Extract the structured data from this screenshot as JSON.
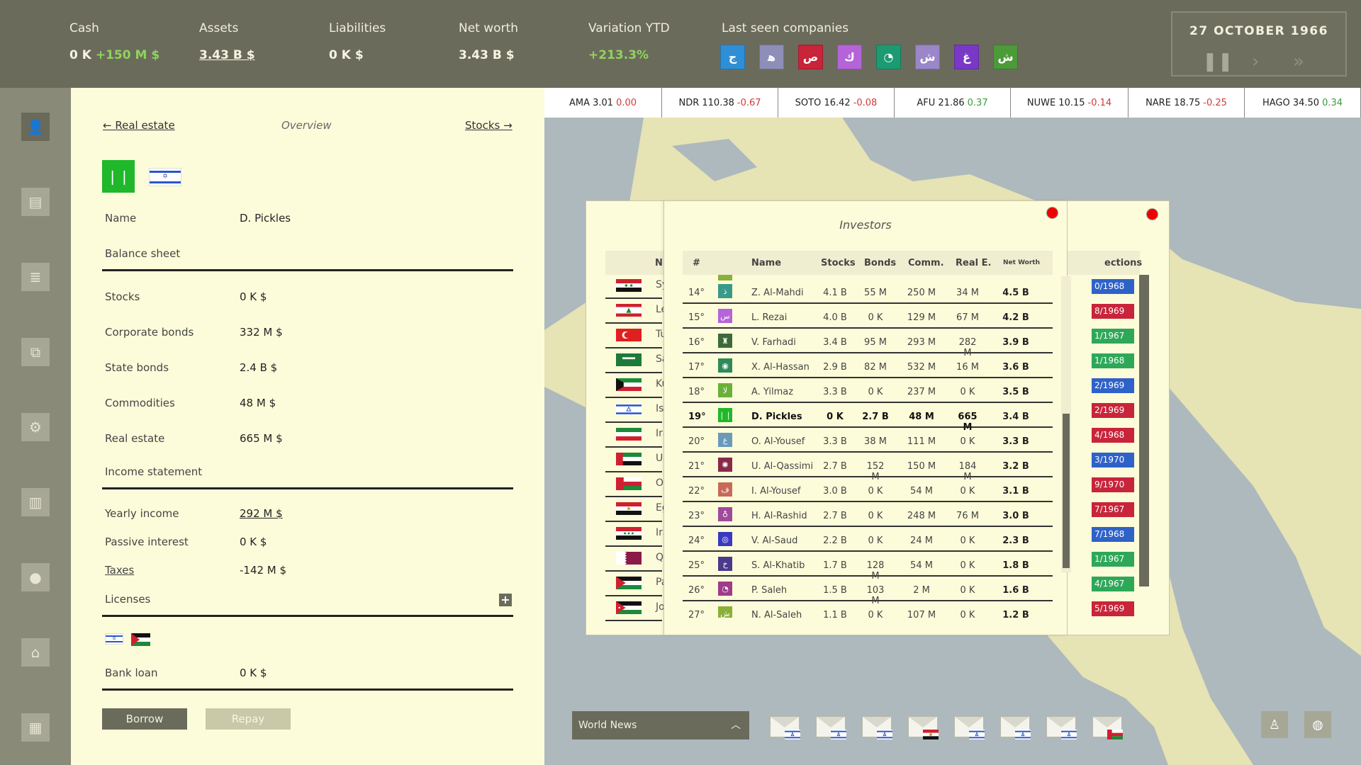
{
  "top": {
    "cash_label": "Cash",
    "cash_value": "0 K",
    "cash_delta": "+150 M $",
    "assets_label": "Assets",
    "assets_value": "3.43 B $",
    "liabilities_label": "Liabilities",
    "liabilities_value": "0 K $",
    "networth_label": "Net worth",
    "networth_value": "3.43 B $",
    "variation_label": "Variation YTD",
    "variation_value": "+213.3%",
    "last_seen_label": "Last seen companies",
    "companies": [
      {
        "glyph": "ج",
        "color": "#2f8fd6"
      },
      {
        "glyph": "ﻫ",
        "color": "#8d8fb8"
      },
      {
        "glyph": "ص",
        "color": "#c8243a"
      },
      {
        "glyph": "ك",
        "color": "#b464d8"
      },
      {
        "glyph": "◔",
        "color": "#1c9a72"
      },
      {
        "glyph": "ش",
        "color": "#9a86c8"
      },
      {
        "glyph": "غ",
        "color": "#7a38c6"
      },
      {
        "glyph": "ش",
        "color": "#4c9a38"
      }
    ],
    "date": "27 OCTOBER 1966",
    "pause_icon": "pause-icon",
    "play_icon": "play-icon",
    "fast_icon": "fast-forward-icon"
  },
  "sidebar": [
    {
      "name": "sidebar-profile",
      "icon": "person-icon",
      "glyph": "👤",
      "active": true
    },
    {
      "name": "sidebar-documents",
      "icon": "document-icon",
      "glyph": "▤"
    },
    {
      "name": "sidebar-database",
      "icon": "database-icon",
      "glyph": "≣"
    },
    {
      "name": "sidebar-papers",
      "icon": "papers-icon",
      "glyph": "⧉"
    },
    {
      "name": "sidebar-settings",
      "icon": "gear-icon",
      "glyph": "⚙"
    },
    {
      "name": "sidebar-buildings",
      "icon": "building-icon",
      "glyph": "▥"
    },
    {
      "name": "sidebar-oil",
      "icon": "oil-drop-icon",
      "glyph": "●"
    },
    {
      "name": "sidebar-bank",
      "icon": "bank-icon",
      "glyph": "⌂"
    },
    {
      "name": "sidebar-factory",
      "icon": "factory-icon",
      "glyph": "▦"
    }
  ],
  "panel": {
    "nav_prev": "← Real estate",
    "nav_mid": "Overview",
    "nav_next": "Stocks →",
    "logo_glyph": "❘❘",
    "name_label": "Name",
    "name_value": "D. Pickles",
    "balance_title": "Balance sheet",
    "stocks_label": "Stocks",
    "stocks_value": "0 K $",
    "corp_label": "Corporate bonds",
    "corp_value": "332 M $",
    "state_label": "State bonds",
    "state_value": "2.4 B $",
    "comm_label": "Commodities",
    "comm_value": "48 M $",
    "re_label": "Real estate",
    "re_value": "665 M $",
    "income_title": "Income statement",
    "yearly_label": "Yearly income",
    "yearly_value": "292 M $",
    "passive_label": "Passive interest",
    "passive_value": "0 K $",
    "taxes_label": "Taxes",
    "taxes_value": "-142 M $",
    "licenses_title": "Licenses",
    "licenses_add": "+",
    "loan_label": "Bank loan",
    "loan_value": "0 K $",
    "borrow": "Borrow",
    "repay": "Repay"
  },
  "ticker": [
    {
      "sym": "AMA",
      "price": "3.01",
      "chg": "0.00",
      "dir": "neg"
    },
    {
      "sym": "NDR",
      "price": "110.38",
      "chg": "-0.67",
      "dir": "neg"
    },
    {
      "sym": "SOTO",
      "price": "16.42",
      "chg": "-0.08",
      "dir": "neg"
    },
    {
      "sym": "AFU",
      "price": "21.86",
      "chg": "0.37",
      "dir": "up"
    },
    {
      "sym": "NUWE",
      "price": "10.15",
      "chg": "-0.14",
      "dir": "neg"
    },
    {
      "sym": "NARE",
      "price": "18.75",
      "chg": "-0.25",
      "dir": "neg"
    },
    {
      "sym": "HAGO",
      "price": "34.50",
      "chg": "0.34",
      "dir": "up"
    }
  ],
  "elections": {
    "col_name": "N",
    "col_elections": "ections",
    "rows": [
      {
        "name": "Sy",
        "flag": "syria",
        "date": "0/1968",
        "color": "#2f62c8"
      },
      {
        "name": "Le",
        "flag": "lebanon",
        "date": "8/1969",
        "color": "#c8243a"
      },
      {
        "name": "Tu",
        "flag": "turkey",
        "date": "1/1967",
        "color": "#2ea858"
      },
      {
        "name": "Sa",
        "flag": "saudi",
        "date": "1/1968",
        "color": "#2ea858"
      },
      {
        "name": "Ku",
        "flag": "kuwait",
        "date": "2/1969",
        "color": "#2f62c8"
      },
      {
        "name": "Is",
        "flag": "israel",
        "date": "2/1969",
        "color": "#c8243a"
      },
      {
        "name": "Ira",
        "flag": "iran",
        "date": "4/1968",
        "color": "#c8243a"
      },
      {
        "name": "U.",
        "flag": "uae",
        "date": "3/1970",
        "color": "#2f62c8"
      },
      {
        "name": "O",
        "flag": "oman",
        "date": "9/1970",
        "color": "#c8243a"
      },
      {
        "name": "Eg",
        "flag": "egypt",
        "date": "7/1967",
        "color": "#c8243a"
      },
      {
        "name": "Ira",
        "flag": "iraq",
        "date": "7/1968",
        "color": "#2f62c8"
      },
      {
        "name": "Q",
        "flag": "qatar",
        "date": "1/1967",
        "color": "#2ea858"
      },
      {
        "name": "Pa",
        "flag": "palestine",
        "date": "4/1967",
        "color": "#2ea858"
      },
      {
        "name": "Jo",
        "flag": "jordan",
        "date": "5/1969",
        "color": "#c8243a"
      }
    ]
  },
  "investors": {
    "title": "Investors",
    "headers": {
      "rank": "#",
      "name": "Name",
      "stocks": "Stocks",
      "bonds": "Bonds",
      "comm": "Comm.",
      "re": "Real E.",
      "nw": "Net Worth"
    },
    "rows": [
      {
        "rank": "14°",
        "name": "Z. Al-Mahdi",
        "stocks": "4.1 B",
        "bonds": "55 M",
        "comm": "250 M",
        "re": "34 M",
        "nw": "4.5 B",
        "icon": "ذ",
        "color": "#3a9a8a"
      },
      {
        "rank": "15°",
        "name": "L. Rezai",
        "stocks": "4.0 B",
        "bonds": "0 K",
        "comm": "129 M",
        "re": "67 M",
        "nw": "4.2 B",
        "icon": "س",
        "color": "#b464d8"
      },
      {
        "rank": "16°",
        "name": "V. Farhadi",
        "stocks": "3.4 B",
        "bonds": "95 M",
        "comm": "293 M",
        "re": "282 M",
        "nw": "3.9 B",
        "icon": "♜",
        "color": "#3e6a3a"
      },
      {
        "rank": "17°",
        "name": "X. Al-Hassan",
        "stocks": "2.9 B",
        "bonds": "82 M",
        "comm": "532 M",
        "re": "16 M",
        "nw": "3.6 B",
        "icon": "◉",
        "color": "#2e8a58"
      },
      {
        "rank": "18°",
        "name": "A. Yilmaz",
        "stocks": "3.3 B",
        "bonds": "0 K",
        "comm": "237 M",
        "re": "0 K",
        "nw": "3.5 B",
        "icon": "ﻻ",
        "color": "#6ab03a"
      },
      {
        "rank": "19°",
        "name": "D. Pickles",
        "stocks": "0 K",
        "bonds": "2.7 B",
        "comm": "48 M",
        "re": "665 M",
        "nw": "3.4 B",
        "icon": "❘❘",
        "color": "#1fb82a",
        "hl": true
      },
      {
        "rank": "20°",
        "name": "O. Al-Yousef",
        "stocks": "3.3 B",
        "bonds": "38 M",
        "comm": "111 M",
        "re": "0 K",
        "nw": "3.3 B",
        "icon": "ع",
        "color": "#6a9ab8"
      },
      {
        "rank": "21°",
        "name": "U. Al-Qassimi",
        "stocks": "2.7 B",
        "bonds": "152 M",
        "comm": "150 M",
        "re": "184 M",
        "nw": "3.2 B",
        "icon": "✺",
        "color": "#8a2a4a"
      },
      {
        "rank": "22°",
        "name": "I. Al-Yousef",
        "stocks": "3.0 B",
        "bonds": "0 K",
        "comm": "54 M",
        "re": "0 K",
        "nw": "3.1 B",
        "icon": "ف",
        "color": "#c86a5a"
      },
      {
        "rank": "23°",
        "name": "H. Al-Rashid",
        "stocks": "2.7 B",
        "bonds": "0 K",
        "comm": "248 M",
        "re": "76 M",
        "nw": "3.0 B",
        "icon": "♁",
        "color": "#a04a9a"
      },
      {
        "rank": "24°",
        "name": "V. Al-Saud",
        "stocks": "2.2 B",
        "bonds": "0 K",
        "comm": "24 M",
        "re": "0 K",
        "nw": "2.3 B",
        "icon": "◎",
        "color": "#3a3ac0"
      },
      {
        "rank": "25°",
        "name": "S. Al-Khatib",
        "stocks": "1.7 B",
        "bonds": "128 M",
        "comm": "54 M",
        "re": "0 K",
        "nw": "1.8 B",
        "icon": "خ",
        "color": "#4a3a8a"
      },
      {
        "rank": "26°",
        "name": "P. Saleh",
        "stocks": "1.5 B",
        "bonds": "103 M",
        "comm": "2 M",
        "re": "0 K",
        "nw": "1.6 B",
        "icon": "◔",
        "color": "#a03a8a"
      },
      {
        "rank": "27°",
        "name": "N. Al-Saleh",
        "stocks": "1.1 B",
        "bonds": "0 K",
        "comm": "107 M",
        "re": "0 K",
        "nw": "1.2 B",
        "icon": "ش",
        "color": "#8ab03a"
      }
    ]
  },
  "bottom": {
    "world_news": "World News",
    "envelope_flags": [
      "israel",
      "israel",
      "israel",
      "egypt",
      "israel",
      "israel",
      "israel",
      "oman"
    ]
  },
  "colors": {
    "accent": "#6b6b5c",
    "panel": "#fdfcda",
    "positive": "#8fd45a",
    "negative": "#d23a3a",
    "close": "#e00000"
  }
}
